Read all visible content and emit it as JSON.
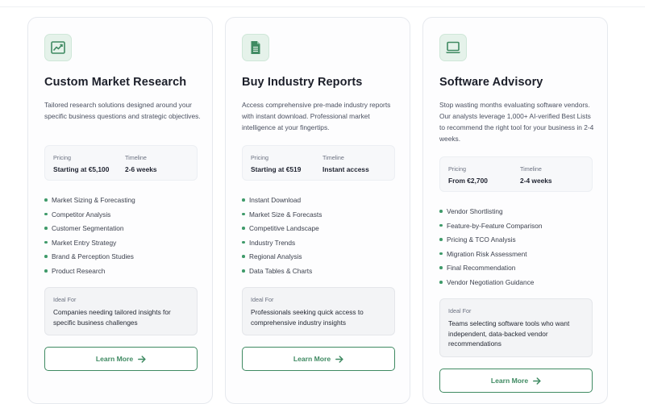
{
  "colors": {
    "accent": "#3f8a62",
    "bullet": "#3f9a6a",
    "icon_bg": "#e5f2ea"
  },
  "cards": [
    {
      "icon": "trending-chart-icon",
      "title": "Custom Market Research",
      "description": "Tailored research solutions designed around your specific business questions and strategic objectives.",
      "pricing_label": "Pricing",
      "pricing_value": "Starting at €5,100",
      "timeline_label": "Timeline",
      "timeline_value": "2-6 weeks",
      "features": [
        "Market Sizing & Forecasting",
        "Competitor Analysis",
        "Customer Segmentation",
        "Market Entry Strategy",
        "Brand & Perception Studies",
        "Product Research"
      ],
      "ideal_label": "Ideal For",
      "ideal_text": "Companies needing tailored insights for specific business challenges",
      "button_label": "Learn More"
    },
    {
      "icon": "document-icon",
      "title": "Buy Industry Reports",
      "description": "Access comprehensive pre-made industry reports with instant download. Professional market intelligence at your fingertips.",
      "pricing_label": "Pricing",
      "pricing_value": "Starting at €519",
      "timeline_label": "Timeline",
      "timeline_value": "Instant access",
      "features": [
        "Instant Download",
        "Market Size & Forecasts",
        "Competitive Landscape",
        "Industry Trends",
        "Regional Analysis",
        "Data Tables & Charts"
      ],
      "ideal_label": "Ideal For",
      "ideal_text": "Professionals seeking quick access to comprehensive industry insights",
      "button_label": "Learn More"
    },
    {
      "icon": "laptop-icon",
      "title": "Software Advisory",
      "description": "Stop wasting months evaluating software vendors. Our analysts leverage 1,000+ AI-verified Best Lists to recommend the right tool for your business in 2-4 weeks.",
      "pricing_label": "Pricing",
      "pricing_value": "From €2,700",
      "timeline_label": "Timeline",
      "timeline_value": "2-4 weeks",
      "features": [
        "Vendor Shortlisting",
        "Feature-by-Feature Comparison",
        "Pricing & TCO Analysis",
        "Migration Risk Assessment",
        "Final Recommendation",
        "Vendor Negotiation Guidance"
      ],
      "ideal_label": "Ideal For",
      "ideal_text": "Teams selecting software tools who want independent, data-backed vendor recommendations",
      "button_label": "Learn More"
    }
  ]
}
